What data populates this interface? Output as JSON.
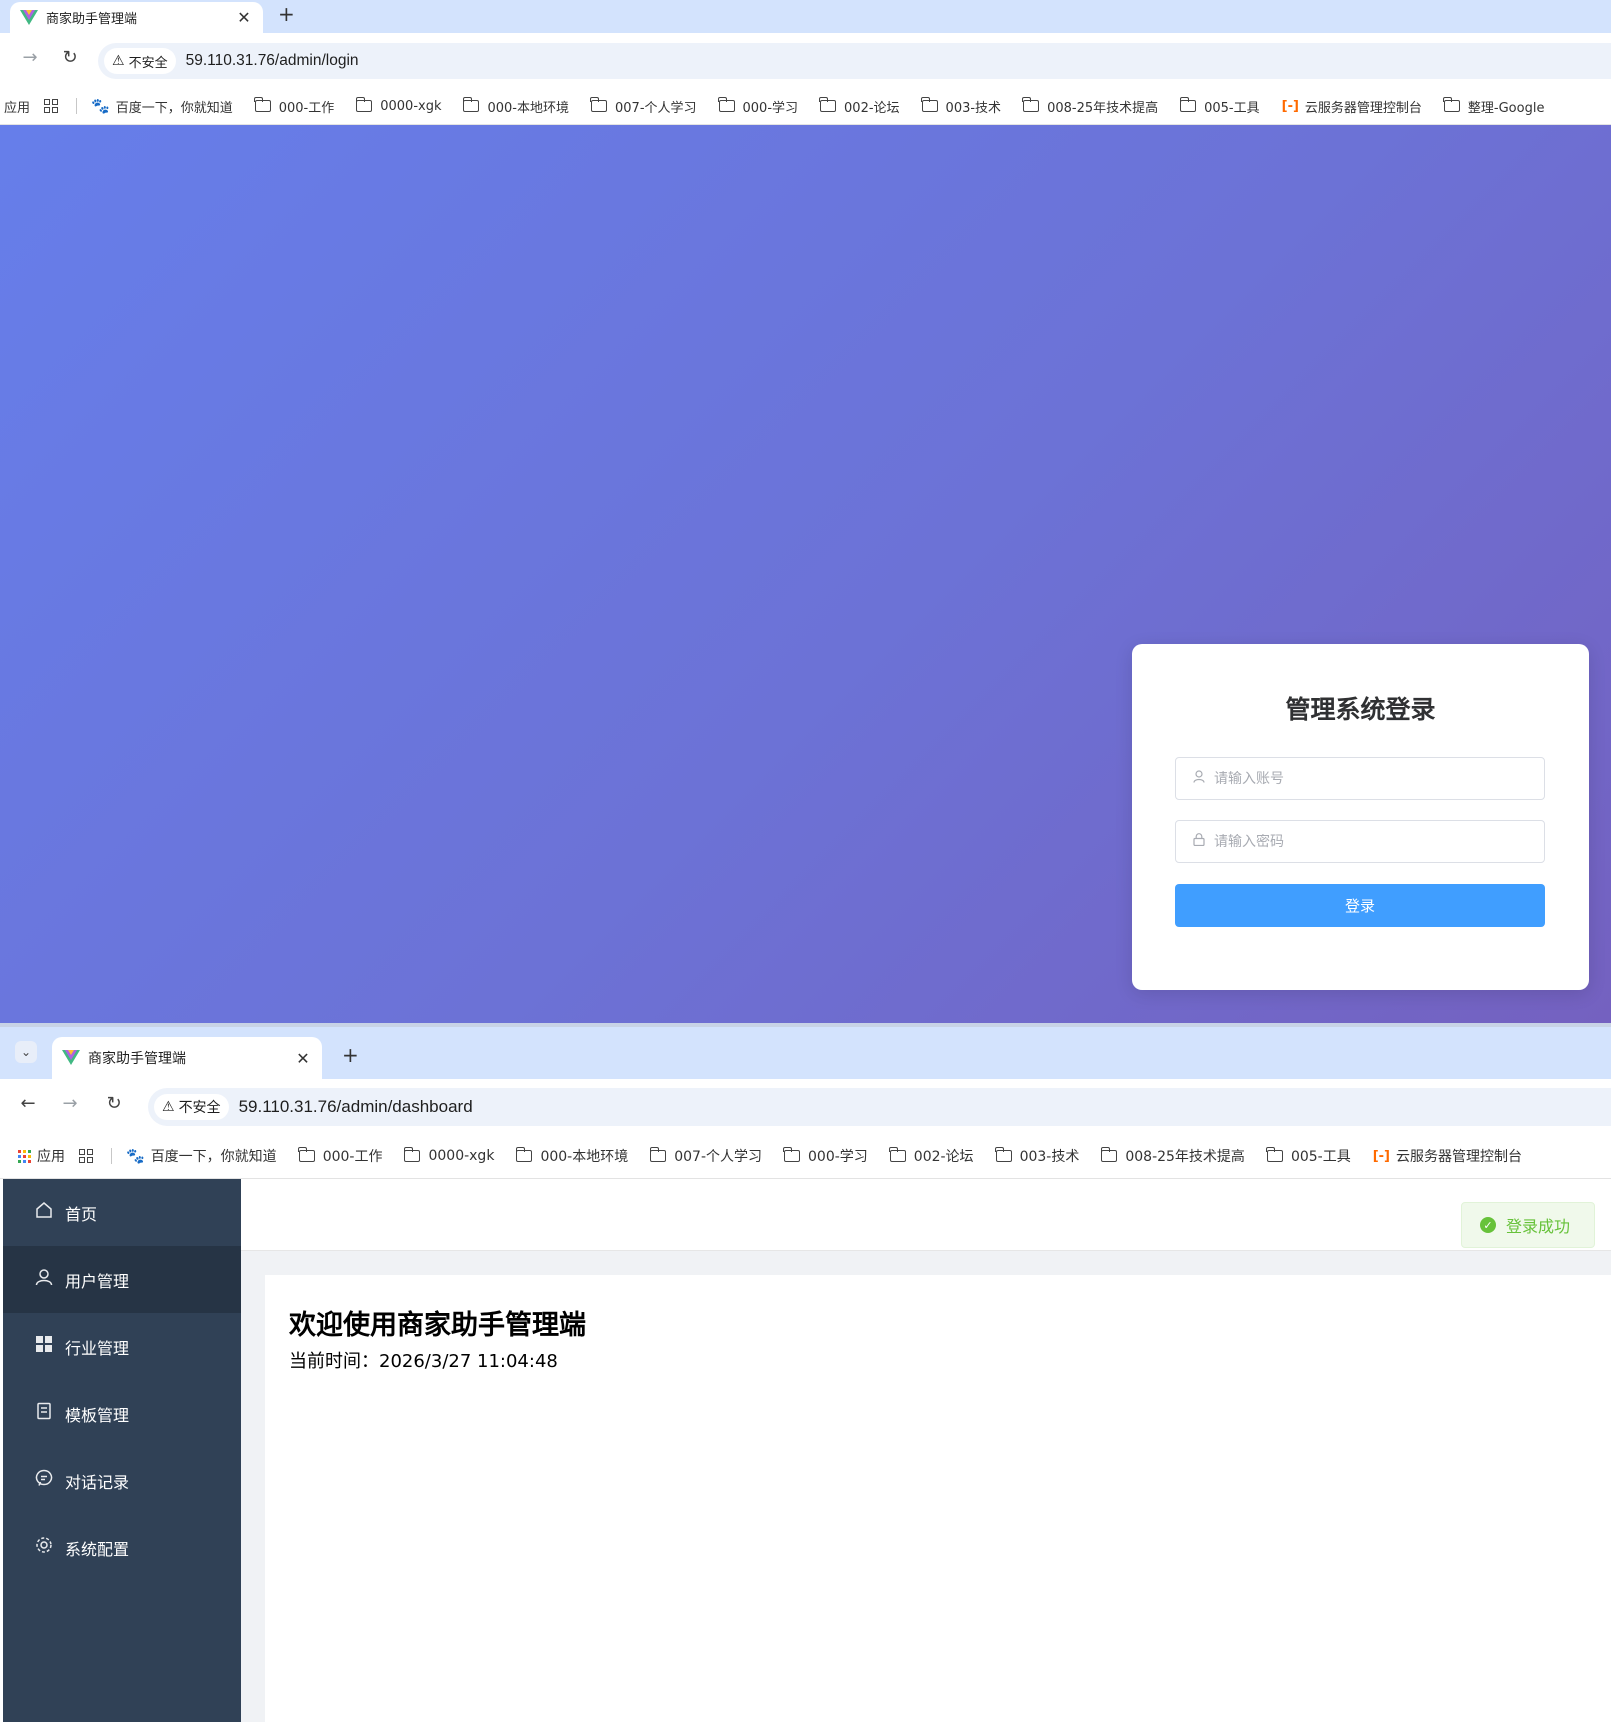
{
  "login_window": {
    "tab_title": "商家助手管理端",
    "url": "59.110.31.76/admin/login",
    "security_label": "不安全",
    "bookmarks": [
      "应用",
      "百度一下，你就知道",
      "000-工作",
      "0000-xgk",
      "000-本地环境",
      "007-个人学习",
      "000-学习",
      "002-论坛",
      "003-技术",
      "008-25年技术提高",
      "005-工具",
      "云服务器管理控制台",
      "整理-Google"
    ],
    "login": {
      "title": "管理系统登录",
      "username_placeholder": "请输入账号",
      "password_placeholder": "请输入密码",
      "submit_label": "登录"
    }
  },
  "dashboard_window": {
    "tab_title": "商家助手管理端",
    "url": "59.110.31.76/admin/dashboard",
    "security_label": "不安全",
    "bookmarks": [
      "应用",
      "百度一下，你就知道",
      "000-工作",
      "0000-xgk",
      "000-本地环境",
      "007-个人学习",
      "000-学习",
      "002-论坛",
      "003-技术",
      "008-25年技术提高",
      "005-工具",
      "云服务器管理控制台"
    ],
    "sidebar": {
      "items": [
        {
          "label": "首页",
          "icon": "home-icon"
        },
        {
          "label": "用户管理",
          "icon": "user-icon"
        },
        {
          "label": "行业管理",
          "icon": "grid-icon"
        },
        {
          "label": "模板管理",
          "icon": "document-icon"
        },
        {
          "label": "对话记录",
          "icon": "chat-icon"
        },
        {
          "label": "系统配置",
          "icon": "gear-icon"
        }
      ],
      "active_index": 1
    },
    "toast": {
      "message": "登录成功",
      "status": "success"
    },
    "main": {
      "welcome": "欢迎使用商家助手管理端",
      "time_line": "当前时间：2026/3/27 11:04:48"
    }
  },
  "colors": {
    "login_gradient_start": "#667eea",
    "login_gradient_end": "#764ba2",
    "primary_button": "#409eff",
    "sidebar_bg": "#304156",
    "success": "#67c23a"
  }
}
